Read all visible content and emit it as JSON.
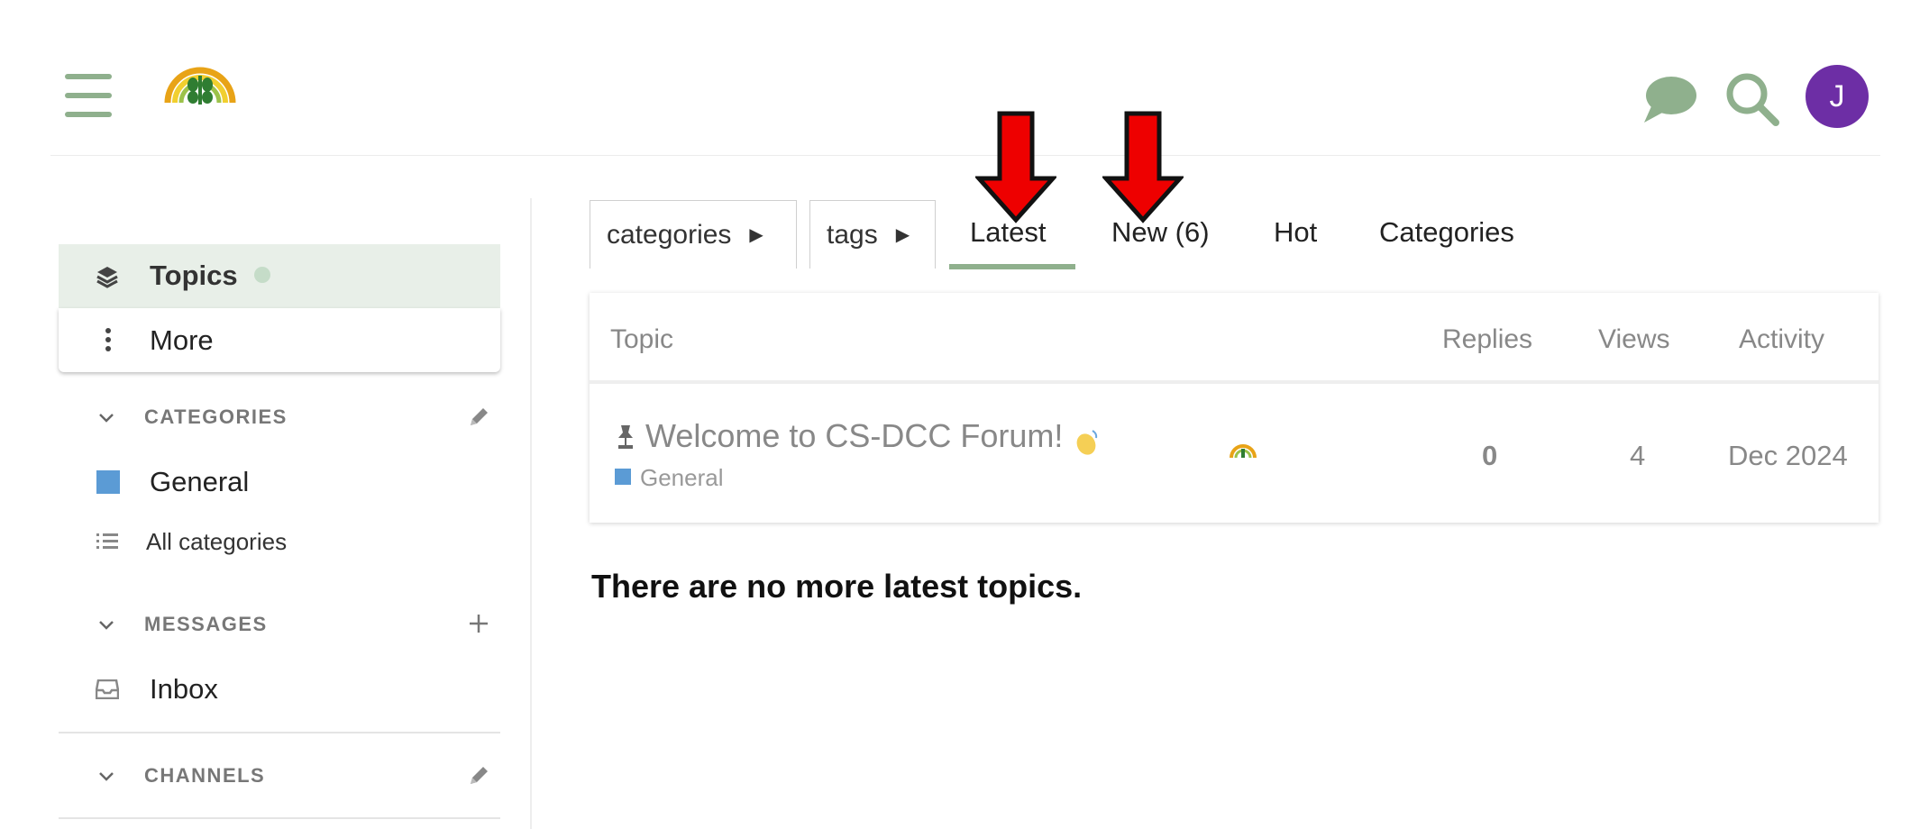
{
  "colors": {
    "accent": "#8fb08d",
    "avatar": "#6d2ea5",
    "category_general": "#5b9bd5",
    "arrow_red": "#ee0000"
  },
  "header": {
    "menu_icon": "hamburger-menu-icon",
    "logo": "forum-logo",
    "chat_icon": "chat-icon",
    "search_icon": "search-icon",
    "avatar_letter": "J"
  },
  "sidebar": {
    "topics_label": "Topics",
    "more_label": "More",
    "categories_heading": "CATEGORIES",
    "categories": [
      {
        "label": "General",
        "color": "#5b9bd5"
      }
    ],
    "all_categories_label": "All categories",
    "messages_heading": "MESSAGES",
    "inbox_label": "Inbox",
    "channels_heading": "CHANNELS"
  },
  "nav": {
    "categories_dropdown": "categories",
    "tags_dropdown": "tags",
    "tabs": [
      {
        "label": "Latest",
        "active": true
      },
      {
        "label": "New (6)",
        "active": false
      },
      {
        "label": "Hot",
        "active": false
      },
      {
        "label": "Categories",
        "active": false
      }
    ]
  },
  "table": {
    "columns": {
      "topic": "Topic",
      "replies": "Replies",
      "views": "Views",
      "activity": "Activity"
    },
    "rows": [
      {
        "title": "Welcome to CS-DCC Forum!",
        "category": "General",
        "replies": "0",
        "views": "4",
        "activity": "Dec 2024",
        "pinned": true
      }
    ]
  },
  "footer_message": "There are no more latest topics."
}
